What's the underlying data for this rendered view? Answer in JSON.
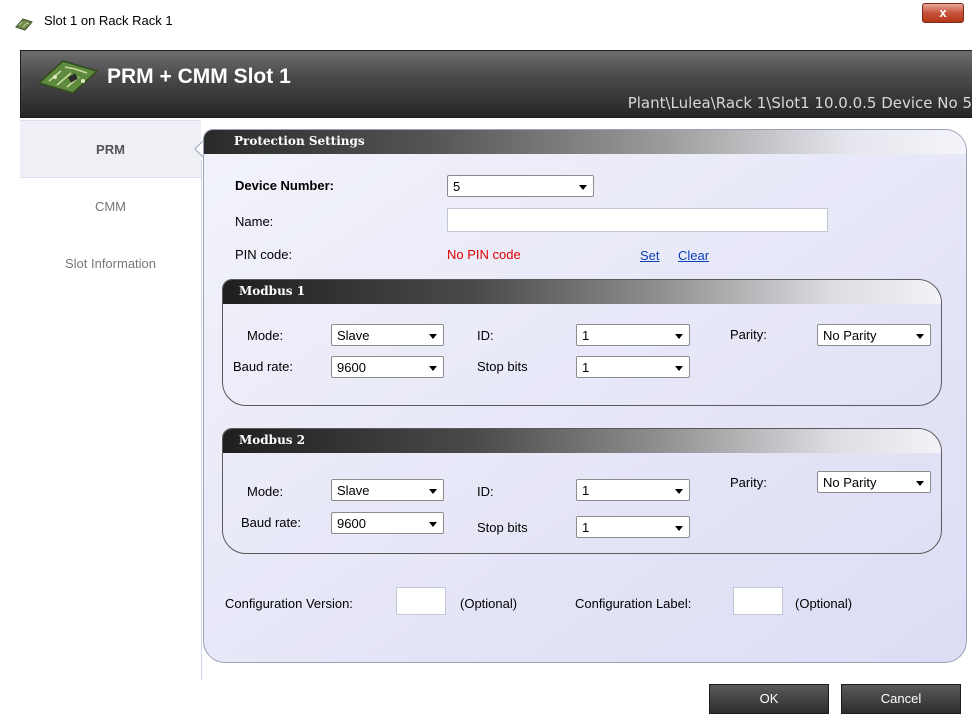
{
  "window": {
    "title": "Slot 1 on Rack Rack 1",
    "close_glyph": "x"
  },
  "header": {
    "title": "PRM + CMM Slot 1",
    "path": "Plant\\Lulea\\Rack 1\\Slot1 10.0.0.5 Device No 5",
    "logo_icon": "circuit-board-icon"
  },
  "sidebar": {
    "items": [
      {
        "label": "PRM",
        "active": true
      },
      {
        "label": "CMM",
        "active": false
      },
      {
        "label": "Slot Information",
        "active": false
      }
    ]
  },
  "protection": {
    "header": "Protection Settings",
    "device_number_label": "Device Number:",
    "device_number_value": "5",
    "name_label": "Name:",
    "name_value": "",
    "pin_label": "PIN code:",
    "pin_status": "No PIN code",
    "set_link": "Set",
    "clear_link": "Clear"
  },
  "modbus1": {
    "header": "Modbus 1",
    "mode_label": "Mode:",
    "mode_value": "Slave",
    "id_label": "ID:",
    "id_value": "1",
    "parity_label": "Parity:",
    "parity_value": "No Parity",
    "baud_label": "Baud rate:",
    "baud_value": "9600",
    "stop_label": "Stop bits",
    "stop_value": "1"
  },
  "modbus2": {
    "header": "Modbus 2",
    "mode_label": "Mode:",
    "mode_value": "Slave",
    "id_label": "ID:",
    "id_value": "1",
    "parity_label": "Parity:",
    "parity_value": "No Parity",
    "baud_label": "Baud rate:",
    "baud_value": "9600",
    "stop_label": "Stop bits",
    "stop_value": "1"
  },
  "config": {
    "version_label": "Configuration Version:",
    "version_value": "",
    "version_optional": "(Optional)",
    "label_label": "Configuration Label:",
    "label_value": "",
    "label_optional": "(Optional)"
  },
  "footer": {
    "ok_label": "OK",
    "cancel_label": "Cancel"
  },
  "colors": {
    "pin_status": "#e00000",
    "link": "#0b3fb8",
    "close_button": "#c7523a"
  }
}
